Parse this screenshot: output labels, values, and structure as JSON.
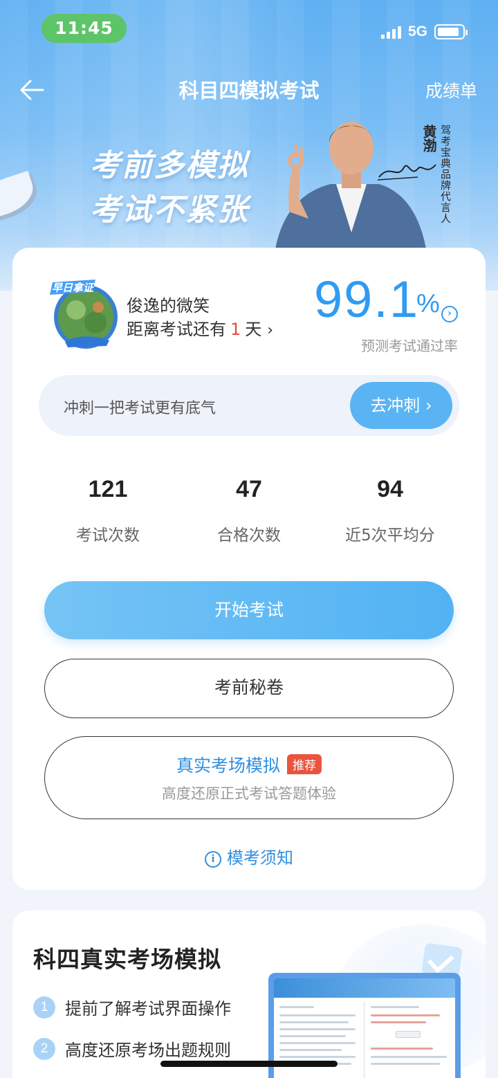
{
  "status_bar": {
    "time": "11:45",
    "network": "5G"
  },
  "nav": {
    "title": "科目四模拟考试",
    "right_link": "成绩单"
  },
  "banner": {
    "slogan_line1": "考前多模拟",
    "slogan_line2": "考试不紧张",
    "endorser_name": "黄渤",
    "endorser_role": "驾考宝典品牌代言人"
  },
  "profile": {
    "badge_text": "早日拿证",
    "user_name": "俊逸的微笑",
    "countdown_prefix": "距离考试还有",
    "countdown_days": "1",
    "countdown_suffix": "天",
    "pass_rate": "99.1",
    "pass_rate_unit": "%",
    "pass_rate_label": "预测考试通过率"
  },
  "sprint": {
    "text": "冲刺一把考试更有底气",
    "button": "去冲刺"
  },
  "stats": [
    {
      "value": "121",
      "label": "考试次数"
    },
    {
      "value": "47",
      "label": "合格次数"
    },
    {
      "value": "94",
      "label": "近5次平均分"
    }
  ],
  "actions": {
    "start": "开始考试",
    "secret": "考前秘卷",
    "real_title": "真实考场模拟",
    "real_tag": "推荐",
    "real_sub": "高度还原正式考试答题体验",
    "notice": "模考须知"
  },
  "section2": {
    "title": "科四真实考场模拟",
    "points": [
      {
        "n": "1",
        "text": "提前了解考试界面操作"
      },
      {
        "n": "2",
        "text": "高度还原考场出题规则"
      }
    ]
  }
}
